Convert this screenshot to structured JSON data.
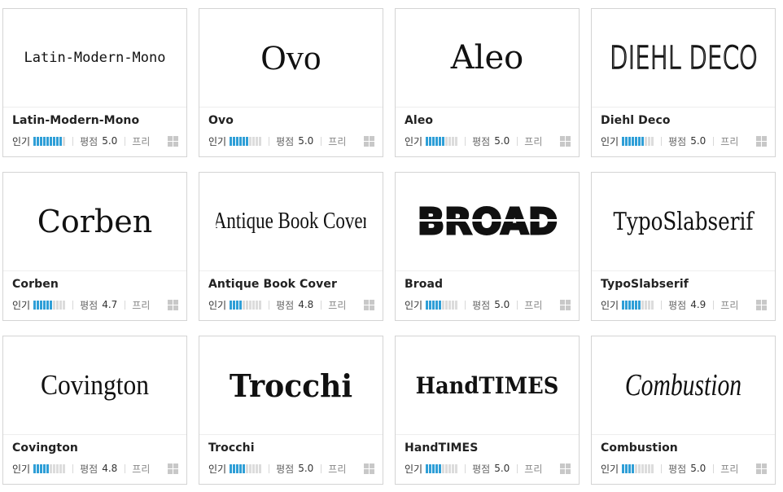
{
  "labels": {
    "popularity": "인기",
    "rating": "평점",
    "license": "프리"
  },
  "colors": {
    "bar_on": "#2f9fd7",
    "bar_off": "#dcdcdc"
  },
  "fonts": [
    {
      "name": "Latin-Modern-Mono",
      "preview": "Latin-Modern-Mono",
      "popularity_bars": 9,
      "score": "5.0"
    },
    {
      "name": "Ovo",
      "preview": "Ovo",
      "popularity_bars": 6,
      "score": "5.0"
    },
    {
      "name": "Aleo",
      "preview": "Aleo",
      "popularity_bars": 6,
      "score": "5.0"
    },
    {
      "name": "Diehl Deco",
      "preview": "DIEHL DECO",
      "popularity_bars": 7,
      "score": "5.0"
    },
    {
      "name": "Corben",
      "preview": "Corben",
      "popularity_bars": 6,
      "score": "4.7"
    },
    {
      "name": "Antique Book Cover",
      "preview": "Antique Book Cover",
      "popularity_bars": 4,
      "score": "4.8"
    },
    {
      "name": "Broad",
      "preview": "BROAD",
      "popularity_bars": 5,
      "score": "5.0"
    },
    {
      "name": "TypoSlabserif",
      "preview": "TypoSlabserif",
      "popularity_bars": 6,
      "score": "4.9"
    },
    {
      "name": "Covington",
      "preview": "Covington",
      "popularity_bars": 5,
      "score": "4.8"
    },
    {
      "name": "Trocchi",
      "preview": "Trocchi",
      "popularity_bars": 5,
      "score": "5.0"
    },
    {
      "name": "HandTIMES",
      "preview": "HandTIMES",
      "popularity_bars": 5,
      "score": "5.0"
    },
    {
      "name": "Combustion",
      "preview": "Combustion",
      "popularity_bars": 4,
      "score": "5.0"
    }
  ]
}
